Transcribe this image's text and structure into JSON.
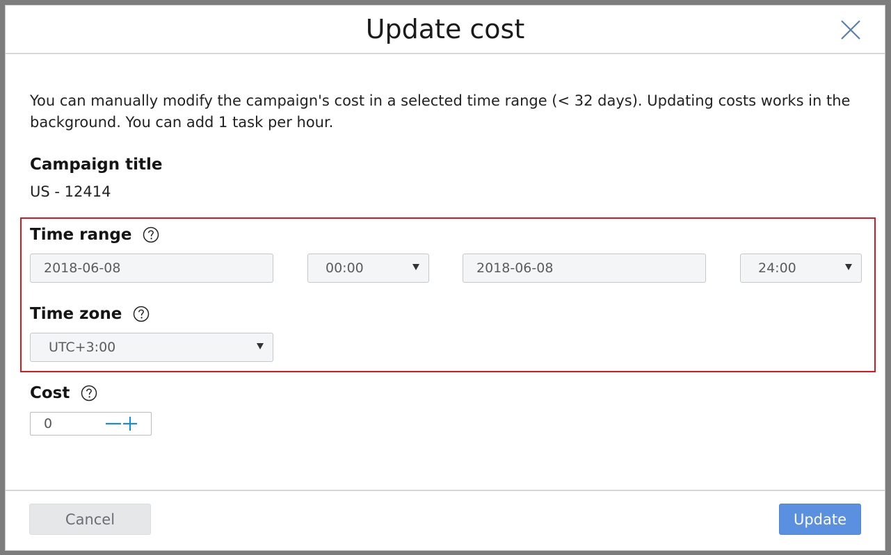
{
  "dialog": {
    "title": "Update cost",
    "description": "You can manually modify the campaign's cost in a selected time range (< 32 days). Updating costs works in the background. You can add 1 task per hour."
  },
  "campaign": {
    "label": "Campaign title",
    "value": "US - 12414"
  },
  "time_range": {
    "label": "Time range",
    "start_date": "2018-06-08",
    "start_time": "00:00",
    "end_date": "2018-06-08",
    "end_time": "24:00"
  },
  "time_zone": {
    "label": "Time zone",
    "value": "UTC+3:00"
  },
  "cost": {
    "label": "Cost",
    "value": "0"
  },
  "footer": {
    "cancel_label": "Cancel",
    "update_label": "Update"
  },
  "colors": {
    "accent": "#5b8fe0",
    "highlight": "#e0161e",
    "stepper": "#1a8bd6"
  },
  "icons": {
    "close": "close-icon",
    "help": "question-circle-icon",
    "minus": "minus-icon",
    "plus": "plus-icon",
    "dropdown": "caret-down-icon"
  }
}
